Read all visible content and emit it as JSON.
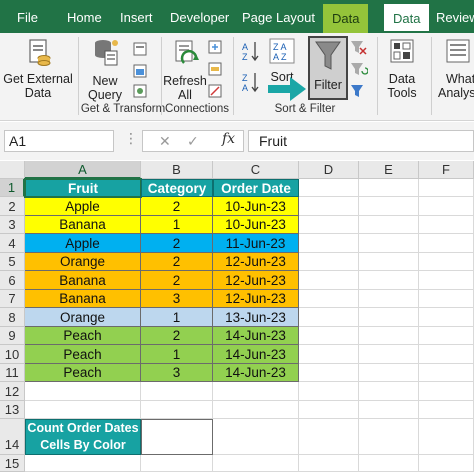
{
  "ribbon_tabs": {
    "file": "File",
    "home": "Home",
    "insert": "Insert",
    "developer": "Developer",
    "page_layout": "Page Layout",
    "data_highlighted": "Data",
    "data_active": "Data",
    "review": "Review"
  },
  "ribbon": {
    "get_external_data": [
      "Get External",
      "Data"
    ],
    "new_query": [
      "New",
      "Query"
    ],
    "refresh_all": [
      "Refresh",
      "All"
    ],
    "sort": "Sort",
    "filter": "Filter",
    "data_tools": [
      "Data",
      "Tools"
    ],
    "what_if": [
      "What",
      "Analysis"
    ],
    "group_get_transform": "Get & Transform",
    "group_connections": "Connections",
    "group_sort_filter": "Sort & Filter"
  },
  "formula_bar": {
    "name_box": "A1",
    "dots": "⋮",
    "fx": "fx",
    "content": "Fruit"
  },
  "columns": [
    "A",
    "B",
    "C",
    "D",
    "E",
    "F"
  ],
  "rows": [
    "1",
    "2",
    "3",
    "4",
    "5",
    "6",
    "7",
    "8",
    "9",
    "10",
    "11",
    "12",
    "13",
    "14",
    "15"
  ],
  "table": {
    "headers": [
      "Fruit",
      "Category",
      "Order Date"
    ],
    "records": [
      {
        "fruit": "Apple",
        "category": "2",
        "date": "10-Jun-23",
        "color": "#ffff00"
      },
      {
        "fruit": "Banana",
        "category": "1",
        "date": "10-Jun-23",
        "color": "#ffff00"
      },
      {
        "fruit": "Apple",
        "category": "2",
        "date": "11-Jun-23",
        "color": "#00b0f0"
      },
      {
        "fruit": "Orange",
        "category": "2",
        "date": "12-Jun-23",
        "color": "#ffc000"
      },
      {
        "fruit": "Banana",
        "category": "2",
        "date": "12-Jun-23",
        "color": "#ffc000"
      },
      {
        "fruit": "Banana",
        "category": "3",
        "date": "12-Jun-23",
        "color": "#ffc000"
      },
      {
        "fruit": "Orange",
        "category": "1",
        "date": "13-Jun-23",
        "color": "#bdd7ee"
      },
      {
        "fruit": "Peach",
        "category": "2",
        "date": "14-Jun-23",
        "color": "#92d050"
      },
      {
        "fruit": "Peach",
        "category": "1",
        "date": "14-Jun-23",
        "color": "#92d050"
      },
      {
        "fruit": "Peach",
        "category": "3",
        "date": "14-Jun-23",
        "color": "#92d050"
      }
    ]
  },
  "count_label": [
    "Count Order Dates",
    "Cells By Color"
  ],
  "colors": {
    "excel_green": "#217346",
    "tab_highlight": "#94c43a",
    "header_teal": "#17a2a2",
    "arrow_teal": "#1aa6a6"
  }
}
